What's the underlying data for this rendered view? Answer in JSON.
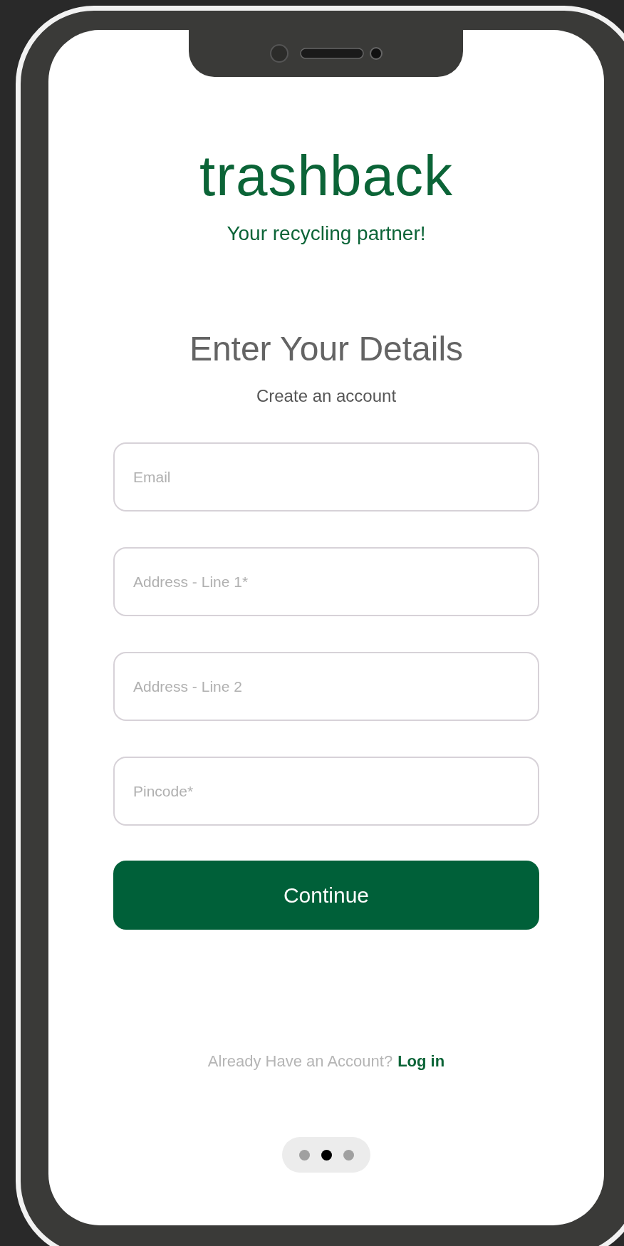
{
  "app": {
    "logo": "trashback",
    "tagline": "Your recycling partner!"
  },
  "heading": "Enter Your Details",
  "subheading": "Create an account",
  "fields": [
    {
      "placeholder": "Email"
    },
    {
      "placeholder": "Address - Line 1*"
    },
    {
      "placeholder": "Address - Line 2"
    },
    {
      "placeholder": "Pincode*"
    }
  ],
  "continue_button": "Continue",
  "footer": {
    "prompt": "Already Have an Account?",
    "link": "Log in"
  },
  "pager": [
    {
      "selected": false
    },
    {
      "selected": true
    },
    {
      "selected": false
    }
  ]
}
